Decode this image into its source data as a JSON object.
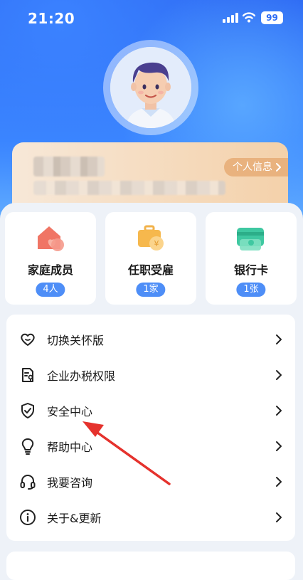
{
  "status_bar": {
    "time": "21:20",
    "battery": "99"
  },
  "profile": {
    "personal_info_button": "个人信息"
  },
  "tiles": [
    {
      "label": "家庭成员",
      "badge": "4人",
      "icon": "family-house-heart-icon"
    },
    {
      "label": "任职受雇",
      "badge": "1家",
      "icon": "briefcase-yuan-icon"
    },
    {
      "label": "银行卡",
      "badge": "1张",
      "icon": "bank-card-icon"
    }
  ],
  "menu": [
    {
      "label": "切换关怀版",
      "icon": "heart-outline-icon"
    },
    {
      "label": "企业办税权限",
      "icon": "document-key-icon"
    },
    {
      "label": "安全中心",
      "icon": "shield-check-icon"
    },
    {
      "label": "帮助中心",
      "icon": "lightbulb-icon"
    },
    {
      "label": "我要咨询",
      "icon": "headset-icon"
    },
    {
      "label": "关于&更新",
      "icon": "info-circle-icon"
    }
  ],
  "colors": {
    "primary_blue": "#3a7af5",
    "badge_blue": "#4e8ef7",
    "annotation_red": "#e5322d",
    "info_card_accent": "#e9b27e"
  }
}
